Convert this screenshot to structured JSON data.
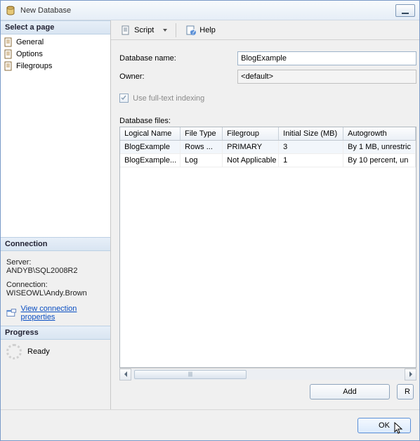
{
  "window": {
    "title": "New Database"
  },
  "toolbar": {
    "script": "Script",
    "help": "Help"
  },
  "left": {
    "select_page": "Select a page",
    "pages": [
      {
        "label": "General"
      },
      {
        "label": "Options"
      },
      {
        "label": "Filegroups"
      }
    ],
    "connection_header": "Connection",
    "server_label": "Server:",
    "server_value": "ANDYB\\SQL2008R2",
    "connection_label": "Connection:",
    "connection_value": "WISEOWL\\Andy.Brown",
    "view_props": "View connection properties",
    "progress_header": "Progress",
    "progress_text": "Ready"
  },
  "form": {
    "dbname_label": "Database name:",
    "dbname_value": "BlogExample",
    "owner_label": "Owner:",
    "owner_value": "<default>",
    "fulltext_label": "Use full-text indexing",
    "files_label": "Database files:"
  },
  "grid": {
    "headers": {
      "logical": "Logical Name",
      "filetype": "File Type",
      "filegroup": "Filegroup",
      "initsize": "Initial Size (MB)",
      "autogrowth": "Autogrowth"
    },
    "rows": [
      {
        "logical": "BlogExample",
        "filetype": "Rows ...",
        "filegroup": "PRIMARY",
        "initsize": "3",
        "autogrowth": "By 1 MB, unrestric"
      },
      {
        "logical": "BlogExample...",
        "filetype": "Log",
        "filegroup": "Not Applicable",
        "initsize": "1",
        "autogrowth": "By 10 percent, un"
      }
    ]
  },
  "actions": {
    "add": "Add",
    "remove": "R"
  },
  "footer": {
    "ok": "OK"
  }
}
